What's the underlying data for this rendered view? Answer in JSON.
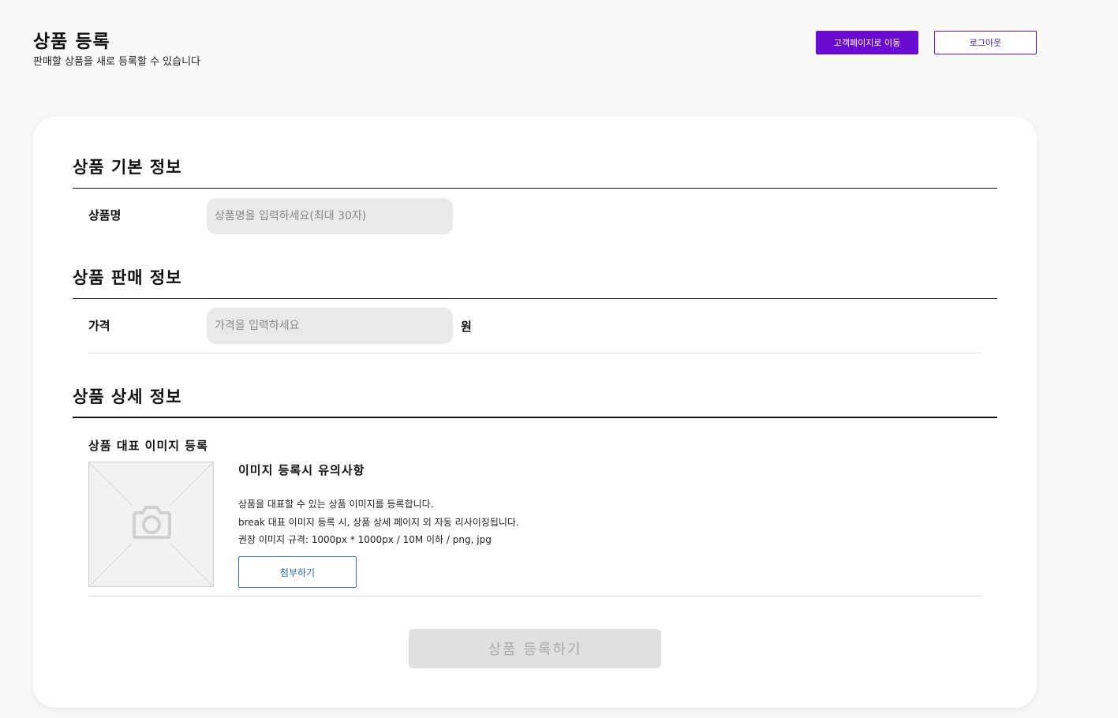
{
  "header": {
    "title": "상품 등록",
    "subtitle": "판매할 상품을 새로 등록할 수 있습니다",
    "customer_page_button": "고객페이지로 이동",
    "logout_button": "로그아웃"
  },
  "sections": {
    "basic": {
      "title": "상품 기본 정보",
      "name_label": "상품명",
      "name_placeholder": "상품명을 입력하세요(최대 30자)",
      "name_value": ""
    },
    "sales": {
      "title": "상품 판매 정보",
      "price_label": "가격",
      "price_placeholder": "가격을 입력하세요",
      "price_value": "",
      "price_unit": "원"
    },
    "detail": {
      "title": "상품 상세 정보",
      "image_label": "상품 대표 이미지 등록",
      "notice_title": "이미지 등록시 유의사항",
      "notice_lines": [
        "상품을 대표할 수 있는 상품 이미지를 등록합니다.",
        "break 대표 이미지 등록 시, 상품 상세 페이지 외 자동 리사이징됩니다.",
        "권장 이미지 규격: 1000px * 1000px / 10M 이하 / png, jpg"
      ],
      "attach_button": "첨부하기"
    }
  },
  "submit_button": "상품 등록하기",
  "colors": {
    "accent": "#6a0bd1",
    "attach_blue": "#2b6cb0",
    "input_bg": "#e9e9e9",
    "disabled_bg": "#e0e0e0",
    "page_bg": "#f9f9f9"
  },
  "icons": {
    "image_placeholder": "camera-icon"
  }
}
